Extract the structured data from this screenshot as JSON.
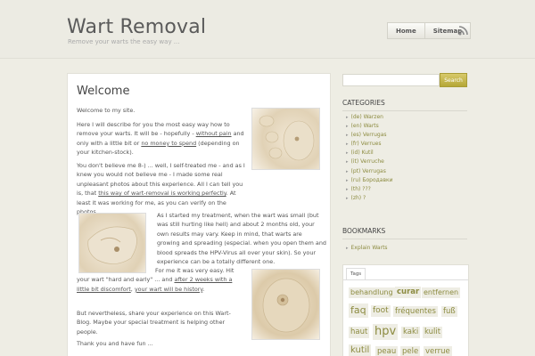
{
  "site": {
    "title": "Wart Removal",
    "description": "Remove your warts the easy way ..."
  },
  "nav": {
    "home": "Home",
    "sitemap": "Sitemap"
  },
  "post": {
    "title": "Welcome",
    "intro": "Welcome to my site.",
    "p1_a": "Here I will describe for you the most easy way how to remove your warts. It will be - hopefully - ",
    "p1_link1": "without pain",
    "p1_b": " and only with a little bit or ",
    "p1_link2": "no money to spend",
    "p1_c": " (depending on your kitchen-stock).",
    "p2_a": "You don't believe me 8-) ... well, I self-treated me - and as I knew you would not believe me - I made some real unpleasant photos about this experience. All I can tell you is, that ",
    "p2_link": "this way of wart-removal is working perfectly",
    "p2_b": ". At least it was working for me, as you can verify on the photos.",
    "p3": "As I started my treatment, when the wart was small (but was still hurting like hell) and about 2 months old, your own results may vary. Keep in mind, that warts are growing and spreading (especial. when you open them and blood spreads the HPV-Virus all over your skin). So your experience can be a totally different one.",
    "p4_a": "For me it was very easy. Hit your wart \"hard and early\" ... and ",
    "p4_link1": "after 2 weeks with a little bit discomfort",
    "p4_b": ", ",
    "p4_link2": "your wart will be history",
    "p4_c": ".",
    "p5": "But nevertheless, share your experience on this Wart-Blog. Maybe your special treatment is helping other people.",
    "p6": "Thank you and have fun ..."
  },
  "search": {
    "button": "Search",
    "placeholder": ""
  },
  "categories": {
    "title": "CATEGORIES",
    "items": [
      "(de) Warzen",
      "(en) Warts",
      "(es) Verrugas",
      "(fr) Verrues",
      "(id) Kutil",
      "(it) Verruche",
      "(pt) Verrugas",
      "(ru) Бородавки",
      "(th) ???",
      "(zh) ?"
    ]
  },
  "bookmarks": {
    "title": "BOOKMARKS",
    "items": [
      "Explain Warts"
    ]
  },
  "tags": {
    "tab": "Tags",
    "items": [
      "behandlung",
      "curar",
      "entfernen",
      "faq",
      "foot",
      "fréquentes",
      "fuß",
      "haut",
      "hpv",
      "kaki",
      "kulit",
      "kutil",
      "peau",
      "pele",
      "verrue"
    ]
  },
  "colors": {
    "accent": "#b5a737",
    "link": "#8c8b40",
    "background": "#eeede4"
  }
}
